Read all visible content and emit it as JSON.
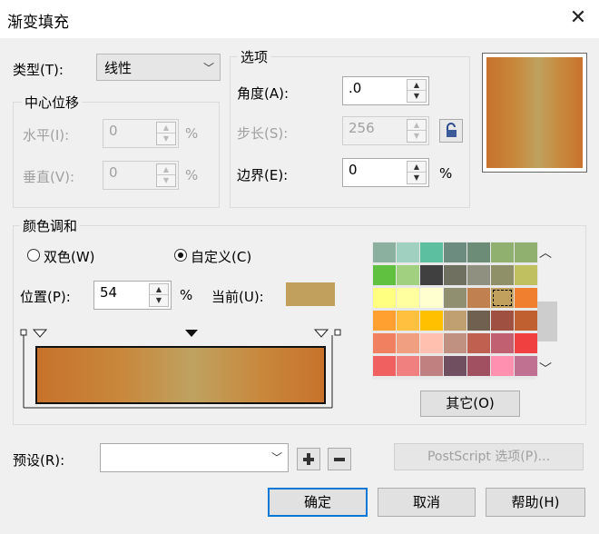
{
  "title": "渐变填充",
  "close_icon": "close-icon",
  "type": {
    "label": "类型(T):",
    "value": "线性"
  },
  "center_offset": {
    "legend": "中心位移",
    "horizontal": {
      "label": "水平(I):",
      "value": "0",
      "unit": "%"
    },
    "vertical": {
      "label": "垂直(V):",
      "value": "0",
      "unit": "%"
    }
  },
  "options": {
    "legend": "选项",
    "angle": {
      "label": "角度(A):",
      "value": ".0"
    },
    "steps": {
      "label": "步长(S):",
      "value": "256"
    },
    "edge": {
      "label": "边界(E):",
      "value": "0",
      "unit": "%"
    }
  },
  "color_blend": {
    "legend": "颜色调和",
    "two_color": "双色(W)",
    "custom": "自定义(C)",
    "custom_selected": true,
    "position": {
      "label": "位置(P):",
      "value": "54",
      "unit": "%"
    },
    "current_label": "当前(U):",
    "current_color": "#c0a05c",
    "other_button": "其它(O)"
  },
  "gradient_colors": {
    "start": "#c8722c",
    "middle": "#bfa260",
    "end": "#c8722c"
  },
  "palette": [
    [
      "#8cb0a0",
      "#a0d0c0",
      "#5cc0a0",
      "#6c8c80",
      "#6c8c78",
      "#90b070",
      "#90b070"
    ],
    [
      "#60c040",
      "#a0d080",
      "#404040",
      "#707060",
      "#909080",
      "#909068",
      "#c0c060"
    ],
    [
      "#ffff80",
      "#ffffa0",
      "#ffffd0",
      "#909070",
      "#c08050",
      "#c0a05c",
      "#f08030"
    ],
    [
      "#ffa030",
      "#ffc040",
      "#ffc000",
      "#c0a070",
      "#706050",
      "#a05040",
      "#c06030"
    ],
    [
      "#f08060",
      "#f0a080",
      "#ffc0b0",
      "#c09080",
      "#c06050",
      "#c06070",
      "#f04040"
    ],
    [
      "#f06060",
      "#f08080",
      "#c08080",
      "#705060",
      "#a05060",
      "#ff90b0",
      "#c07090"
    ]
  ],
  "palette_selected": [
    2,
    5
  ],
  "presets": {
    "label": "预设(R):",
    "value": ""
  },
  "postscript_button": "PostScript 选项(P)...",
  "buttons": {
    "ok": "确定",
    "cancel": "取消",
    "help": "帮助(H)"
  }
}
